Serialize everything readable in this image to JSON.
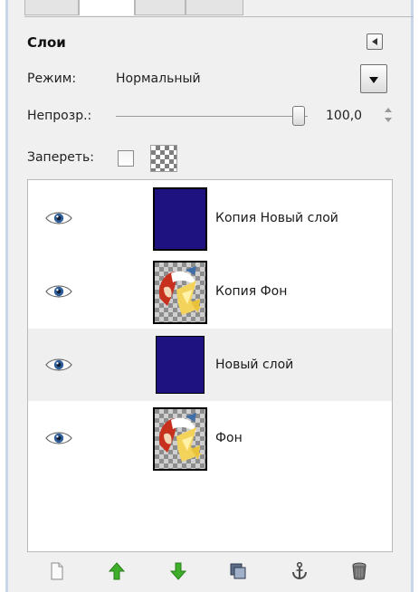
{
  "panel": {
    "title": "Слои"
  },
  "mode": {
    "label": "Режим:",
    "value": "Нормальный"
  },
  "opacity": {
    "label": "Непрозр.:",
    "value": "100,0",
    "fraction": 1.0
  },
  "lock": {
    "label": "Запереть:",
    "pixels_locked": false,
    "alpha_icon": "checkerboard-alpha-icon"
  },
  "layers": [
    {
      "name": "Копия Новый слой",
      "thumbnail": "solid-blue",
      "visible": true,
      "selected": false
    },
    {
      "name": "Копия Фон",
      "thumbnail": "photo",
      "visible": true,
      "selected": false
    },
    {
      "name": "Новый слой",
      "thumbnail": "solid-blue",
      "visible": true,
      "selected": true
    },
    {
      "name": "Фон",
      "thumbnail": "photo",
      "visible": true,
      "selected": false
    }
  ],
  "toolbar": {
    "icons": [
      "new-layer-icon",
      "raise-layer-icon",
      "lower-layer-icon",
      "duplicate-layer-icon",
      "anchor-layer-icon",
      "delete-layer-icon"
    ]
  },
  "colors": {
    "layer_blue": "#1d1280",
    "arrow_green": "#3fae2a",
    "selection_row": "#efefef"
  }
}
